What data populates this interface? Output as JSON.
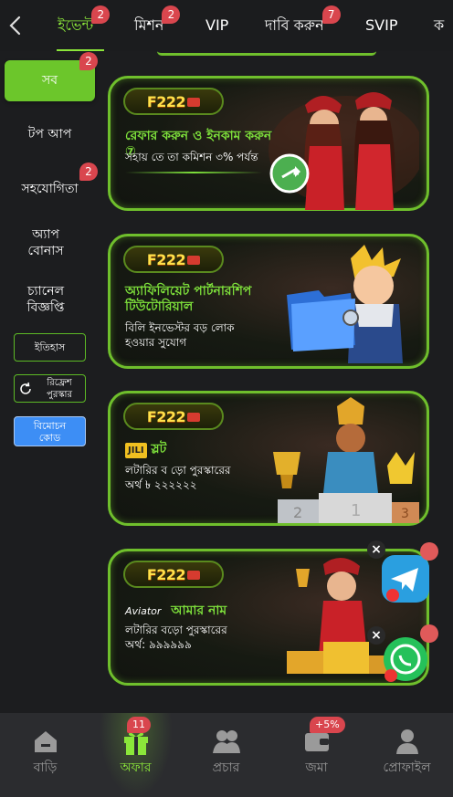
{
  "colors": {
    "accent": "#8be63a",
    "badge": "#d9464e",
    "card_border": "#6fbf2c",
    "info_button": "#3d8ef5"
  },
  "tabs": [
    {
      "label": "ইভেন্ট",
      "badge": "2"
    },
    {
      "label": "মিশন",
      "badge": "2"
    },
    {
      "label": "VIP",
      "badge": ""
    },
    {
      "label": "দাবি করুন",
      "badge": "7"
    },
    {
      "label": "SVIP",
      "badge": ""
    },
    {
      "label": "ক",
      "badge": ""
    }
  ],
  "sidebar": {
    "items": [
      {
        "label": "সব",
        "badge": "2"
      },
      {
        "label": "টপ আপ",
        "badge": ""
      },
      {
        "label": "সহযোগিতা",
        "badge": "2"
      },
      {
        "label": "অ্যাপ বোনাস",
        "badge": ""
      },
      {
        "label": "চ্যানেল বিজ্ঞপ্তি",
        "badge": ""
      }
    ],
    "history_label": "ইতিহাস",
    "refresh_label": "রিফ্রেশ পুরস্কার",
    "redeem_label": "বিমোচন কোড"
  },
  "cards": [
    {
      "logo": "F222",
      "title": "রেফার করুন ও ইনকাম করুন ⑦",
      "desc": "সহায় তে তা কমিশন ৩% পর্যন্ত"
    },
    {
      "logo": "F222",
      "title": "অ্যাফিলিয়েট পার্টনারশিপ টিউটোরিয়াল",
      "desc": "বিলি ইনভেস্টর বড় লোক হওয়ার সুযোগ"
    },
    {
      "logo": "F222",
      "brand": "JILI",
      "title": "স্লট",
      "desc_line1": "লটারির ব ড়ো পুরস্কারের",
      "desc_line2": "অর্থ ৳ ২২২২২২"
    },
    {
      "logo": "F222",
      "brand": "Aviator",
      "title": "আমার নাম",
      "desc_line1": "লটারির বড়ো পুরস্কারের",
      "desc_line2": "অর্থ: ৯৯৯৯৯৯"
    }
  ],
  "bottom_nav": [
    {
      "label": "বাড়ি",
      "icon": "home-icon",
      "badge": ""
    },
    {
      "label": "অফার",
      "icon": "gift-icon",
      "badge": "11"
    },
    {
      "label": "প্রচার",
      "icon": "people-icon",
      "badge": ""
    },
    {
      "label": "জমা",
      "icon": "wallet-icon",
      "badge": "+5%"
    },
    {
      "label": "প্রোফাইল",
      "icon": "profile-icon",
      "badge": ""
    }
  ]
}
